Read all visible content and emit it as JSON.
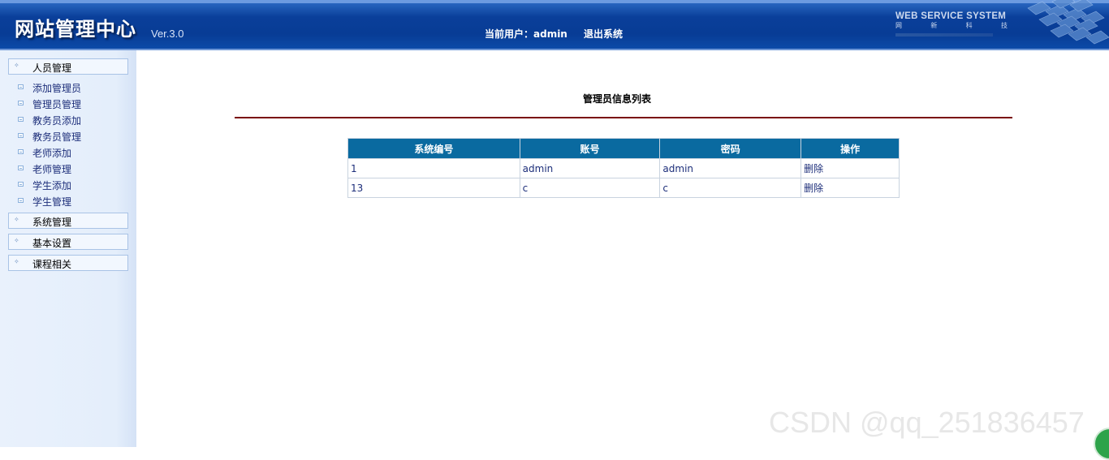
{
  "header": {
    "site_title": "网站管理中心",
    "version": "Ver.3.0",
    "current_user_label": "当前用户：admin",
    "logout_label": "退出系统",
    "brand_title": "WEB SERVICE SYSTEM",
    "brand_sub": [
      "网",
      "新",
      "科",
      "技"
    ]
  },
  "sidebar": {
    "groups": [
      {
        "label": "人员管理"
      },
      {
        "label": "系统管理"
      },
      {
        "label": "基本设置"
      },
      {
        "label": "课程相关"
      }
    ],
    "items": [
      {
        "label": "添加管理员"
      },
      {
        "label": "管理员管理"
      },
      {
        "label": "教务员添加"
      },
      {
        "label": "教务员管理"
      },
      {
        "label": "老师添加"
      },
      {
        "label": "老师管理"
      },
      {
        "label": "学生添加"
      },
      {
        "label": "学生管理"
      }
    ]
  },
  "main": {
    "title": "管理员信息列表",
    "table": {
      "columns": [
        "系统编号",
        "账号",
        "密码",
        "操作"
      ],
      "rows": [
        [
          "1",
          "admin",
          "admin",
          "删除"
        ],
        [
          "13",
          "c",
          "c",
          "删除"
        ]
      ]
    }
  },
  "watermark": "CSDN @qq_251836457",
  "colors": {
    "header_blue": "#083c95",
    "table_header": "#0a6aa0",
    "title_rule": "#7a0b0b",
    "link_text": "#1d2e7a"
  }
}
